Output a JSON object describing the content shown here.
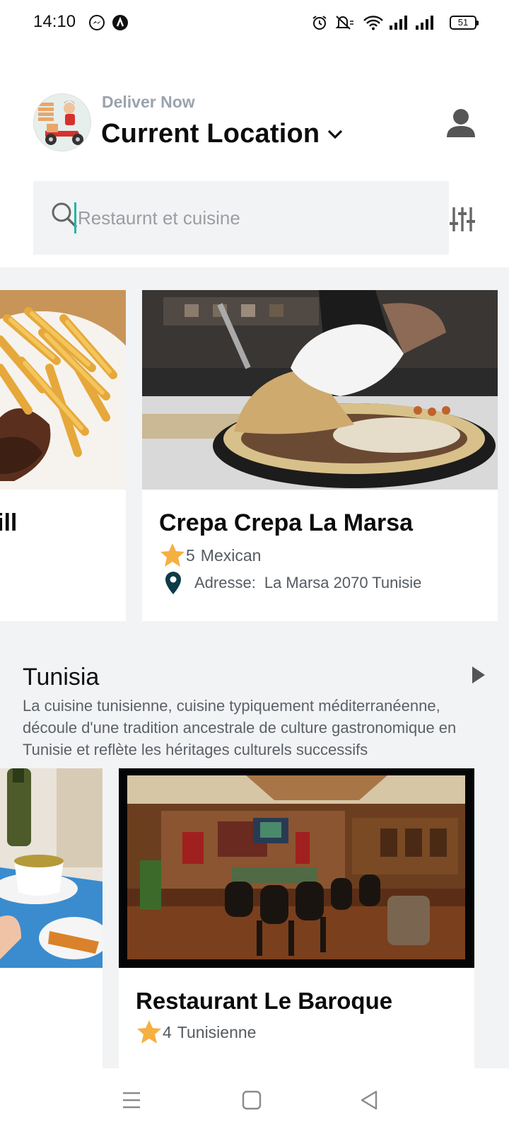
{
  "status_bar": {
    "time": "14:10",
    "battery": "51",
    "left_icons": [
      "messenger-icon",
      "app-notification-icon"
    ],
    "right_icons": [
      "alarm-icon",
      "mute-icon",
      "wifi-icon",
      "signal-icon",
      "signal-icon",
      "battery-icon"
    ]
  },
  "header": {
    "deliver_label": "Deliver Now",
    "location_title": "Current Location"
  },
  "search": {
    "placeholder": "Restaurnt et cuisine"
  },
  "colors": {
    "accent": "#1fb7a6",
    "star": "#f5b041",
    "pin": "#0d3b4a",
    "section_bg": "#f2f3f4"
  },
  "featured_restaurants": [
    {
      "name_partial": "ill",
      "image": "steak-fries-photo"
    },
    {
      "name": "Crepa Crepa La Marsa",
      "rating": "5",
      "cuisine": "Mexican",
      "address_label": "Adresse:",
      "address": "La Marsa 2070 Tunisie",
      "image": "crepe-cooking-photo"
    }
  ],
  "category": {
    "title": "Tunisia",
    "description": "La cuisine tunisienne, cuisine typiquement méditerranéenne, découle d'une tradition ancestrale de culture gastronomique en Tunisie et reflète les héritages culturels successifs"
  },
  "category_restaurants": [
    {
      "image": "tea-table-photo"
    },
    {
      "name": "Restaurant Le Baroque",
      "rating": "4",
      "cuisine": "Tunisienne",
      "image": "restaurant-interior-photo"
    }
  ],
  "nav_bar": [
    "menu-icon",
    "home-icon",
    "back-icon"
  ]
}
